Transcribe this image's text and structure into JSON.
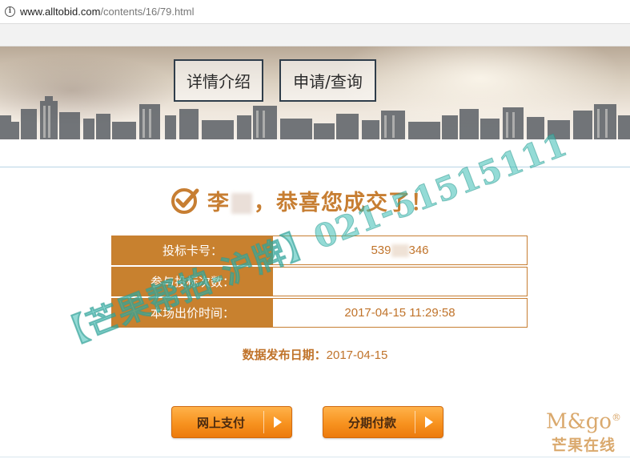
{
  "browser": {
    "url_host": "www.alltobid.com",
    "url_path": "/contents/16/79.html"
  },
  "nav": {
    "details_label": "详情介绍",
    "apply_label": "申请/查询"
  },
  "result": {
    "surname": "李",
    "message": "，恭喜您成交了！"
  },
  "info_table": {
    "card_label": "投标卡号：",
    "card_value_prefix": "539",
    "card_value_suffix": "346",
    "count_label": "参与投标次数：",
    "count_value": "",
    "time_label": "本场出价时间：",
    "time_value": "2017-04-15 11:29:58"
  },
  "publish": {
    "label": "数据发布日期：",
    "value": "2017-04-15"
  },
  "actions": {
    "online_pay": "网上支付",
    "installment": "分期付款"
  },
  "watermark": {
    "text": "【芒果帮拍-沪牌】021-51515111",
    "brand_en": "M&go",
    "brand_reg": "®",
    "brand_cn": "芒果在线"
  },
  "colors": {
    "accent": "#c8812f",
    "button": "#f7921f",
    "watermark": "#3cbeb4"
  }
}
